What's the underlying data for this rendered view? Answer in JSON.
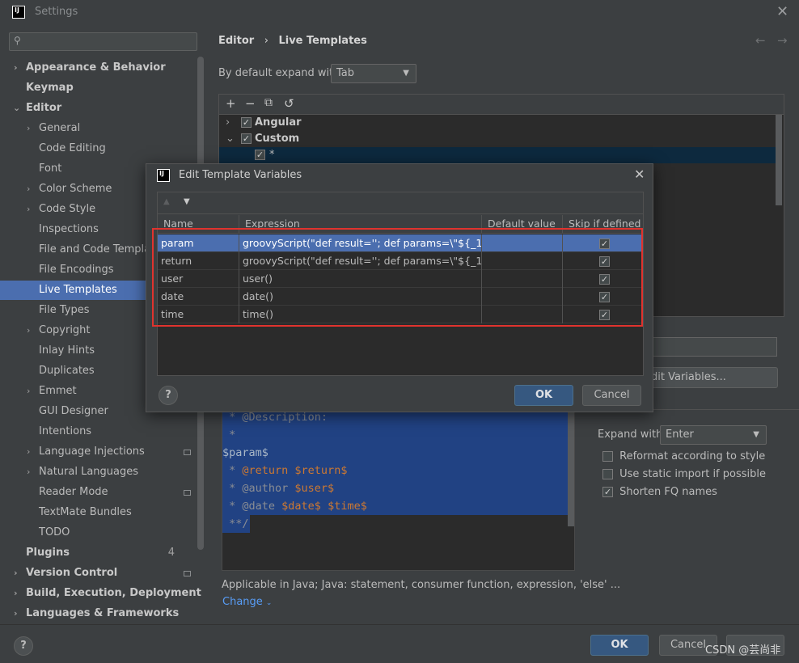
{
  "window": {
    "title": "Settings",
    "logo_text": "IJ",
    "close": "✕"
  },
  "search": {
    "placeholder": "",
    "icon": "search-icon"
  },
  "sidebar": {
    "items": [
      {
        "label": "Appearance & Behavior",
        "expander": "›"
      },
      {
        "label": "Keymap"
      },
      {
        "label": "Editor",
        "expander": "⌄"
      },
      {
        "label": "General",
        "expander": "›"
      },
      {
        "label": "Code Editing"
      },
      {
        "label": "Font"
      },
      {
        "label": "Color Scheme",
        "expander": "›"
      },
      {
        "label": "Code Style",
        "expander": "›"
      },
      {
        "label": "Inspections"
      },
      {
        "label": "File and Code Templates"
      },
      {
        "label": "File Encodings"
      },
      {
        "label": "Live Templates"
      },
      {
        "label": "File Types"
      },
      {
        "label": "Copyright",
        "expander": "›"
      },
      {
        "label": "Inlay Hints"
      },
      {
        "label": "Duplicates"
      },
      {
        "label": "Emmet",
        "expander": "›"
      },
      {
        "label": "GUI Designer"
      },
      {
        "label": "Intentions"
      },
      {
        "label": "Language Injections",
        "expander": "›"
      },
      {
        "label": "Natural Languages",
        "expander": "›"
      },
      {
        "label": "Reader Mode"
      },
      {
        "label": "TextMate Bundles"
      },
      {
        "label": "TODO"
      },
      {
        "label": "Plugins",
        "badge": "4"
      },
      {
        "label": "Version Control",
        "expander": "›"
      },
      {
        "label": "Build, Execution, Deployment",
        "expander": "›"
      },
      {
        "label": "Languages & Frameworks",
        "expander": "›"
      }
    ]
  },
  "breadcrumb": {
    "parent": "Editor",
    "separator": "›",
    "current": "Live Templates",
    "back": "←",
    "forward": "→"
  },
  "expand_default": {
    "label": "By default expand with",
    "value": "Tab"
  },
  "templates_toolbar": {
    "add": "+",
    "remove": "−",
    "copy": "⧉",
    "revert": "↺"
  },
  "template_groups": [
    {
      "name": "Angular",
      "expander": "›",
      "checked": "✓"
    },
    {
      "name": "Custom",
      "expander": "⌄",
      "checked": "✓"
    },
    {
      "name": "*",
      "checked": "✓"
    }
  ],
  "edit_variables_button": "dit Variables...",
  "editor_code": {
    "line1": " * @Description:",
    "line2": " *",
    "line3": "$param$",
    "line4_prefix": " * ",
    "line4_tag": "@return ",
    "line4_var": "$return$",
    "line5_tag": " * @author ",
    "line5_var": "$user$",
    "line6_tag": " * @date ",
    "line6_var1": "$date$",
    "line6_var2": " $time$",
    "line7": " **/"
  },
  "options": {
    "expand_with_label": "Expand with",
    "expand_with_value": "Enter",
    "reformat": "Reformat according to style",
    "static_import": "Use static import if possible",
    "shorten_fq": "Shorten FQ names"
  },
  "applicable": {
    "text": "Applicable in Java; Java: statement, consumer function, expression, 'else' ...",
    "change": "Change"
  },
  "bottom": {
    "help": "?",
    "ok": "OK",
    "cancel": "Cancel"
  },
  "dialog": {
    "title": "Edit Template Variables",
    "logo_text": "IJ",
    "close": "✕",
    "move_up": "▲",
    "move_down": "▼",
    "columns": [
      "Name",
      "Expression",
      "Default value",
      "Skip if defined"
    ],
    "rows": [
      {
        "name": "param",
        "expression": "groovyScript(\"def result=''; def params=\\\"${_1}\\\"...",
        "default": "",
        "skip": "✓"
      },
      {
        "name": "return",
        "expression": "groovyScript(\"def result=''; def params=\\\"${_1}\\\"...",
        "default": "",
        "skip": "✓"
      },
      {
        "name": "user",
        "expression": "user()",
        "default": "",
        "skip": "✓"
      },
      {
        "name": "date",
        "expression": "date()",
        "default": "",
        "skip": "✓"
      },
      {
        "name": "time",
        "expression": "time()",
        "default": "",
        "skip": "✓"
      }
    ],
    "help": "?",
    "ok": "OK",
    "cancel": "Cancel"
  },
  "watermark": "CSDN @芸尚非",
  "colors": {
    "selection": "#4b6eaf",
    "primary_button": "#365880",
    "highlight_box": "#e0332e"
  }
}
